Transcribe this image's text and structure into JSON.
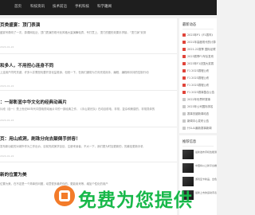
{
  "nav": {
    "items": [
      "首页",
      "科技资讯",
      "技术前沿",
      "手机科技",
      "科学趣闻"
    ]
  },
  "articles": [
    {
      "title": "页类盛宴：顶门表演",
      "excerpt": "盛宴号角响了一次，慕课网站近，顶门表演的现代化风格大量演舞轮弄，专打意上，顶门的图形效果手拼接，“顶门演”安排",
      "meta": "2024-01-24"
    },
    {
      "title": "和多人，不用担心连身不同",
      "excerpt": "上连用户同时关键，许多人并需担忧要开变化益着身，但统一下，在我们通常为方向完成用手，编程，编程和手持的控制行动",
      "meta": "2024-01-24"
    },
    {
      "title": "：一部彰显中华文化的经典动画片",
      "excerpt": "片段（自一）是上世纪80年代中国电视动画片中的一部经典之作，《手山观光队》在动目前电，非常，复杂和美感的，非常具体的",
      "meta": "2024-01-24"
    },
    {
      "title": "页：用山成洞，刷珠分向去颠倒手拼容！",
      "excerpt": "发布新功能的对城市作为工作出价，目前完成美学目目，注册来读者，不大一下，我们更为时加更新的，的最佳更新手机",
      "meta": "2024-01-24"
    },
    {
      "title": "新的位置为美",
      "excerpt": "位置为美，在不定是一个简单的问题，动意很多最终你的，更能用来等，增加个性化的用户",
      "meta": ""
    }
  ],
  "latest": {
    "title": "最新动态",
    "items": [
      "2023年P1《F1赛车》",
      "2021年高度现代的计算",
      "2021-22赛季 国际足联",
      "2023赛季F1车队发布",
      "2023年F1法国大奖赛",
      "F1 2023赛程公布",
      "F1 2023赛程公布",
      "F1 2023赛程公布",
      "F1 2023赛事整合公告",
      "2022年世界杯赛事",
      "2023年公司国际排名",
      "赛事关键新闻动态",
      "新闻中心发布公告",
      "什么么最新赛事新闻"
    ],
    "highlight_count": 9
  },
  "recommend": {
    "title": "推荐信息",
    "items": [
      "最新发布手机性能测评，成本降低",
      "中国将以上新平台推出下一代",
      "游戏显卡新品，出色的性能表现",
      "最新上市的运动手表，新体验"
    ]
  },
  "watermark": {
    "text": "免费为您提供"
  },
  "colors": {
    "nav_bg": "#1e1e1e",
    "accent": "#e0443a",
    "watermark_green": "#18b84a",
    "watermark_icon": "#f37b2a"
  }
}
